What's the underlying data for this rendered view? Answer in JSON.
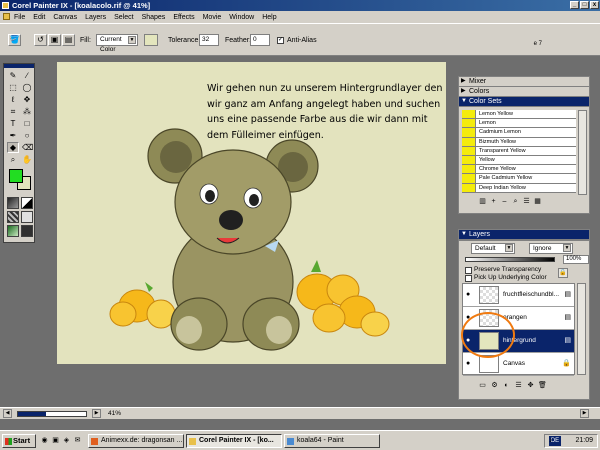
{
  "window": {
    "title": "Corel Painter IX - [koalacolo.rif @ 41%]",
    "minimize": "_",
    "maximize": "□",
    "close": "x"
  },
  "menu": [
    "File",
    "Edit",
    "Canvas",
    "Layers",
    "Select",
    "Shapes",
    "Effects",
    "Movie",
    "Window",
    "Help"
  ],
  "propbar": {
    "fill_label": "Fill:",
    "fill_value": "Current Color",
    "tolerance_label": "Tolerance:",
    "tolerance_value": "32",
    "feather_label": "Feather:",
    "feather_value": "0",
    "antialias_label": "Anti-Alias",
    "antialias_checked": "✓",
    "page_label": "e 7"
  },
  "canvas": {
    "text": "Wir gehen nun zu unserem Hintergrundlayer den wir ganz am Anfang angelegt haben und suchen uns eine passende Farbe aus die wir dann mit dem Fülleimer einfügen."
  },
  "status": {
    "zoom": "41%",
    "zoom_fraction": 0.41
  },
  "panels": {
    "mixer": "Mixer",
    "colors": "Colors",
    "color_sets": "Color Sets",
    "layers": "Layers"
  },
  "color_sets": [
    "Lemon Yellow",
    "Lemon",
    "Cadmium Lemon",
    "Bizmuth Yellow",
    "Transparent Yellow",
    "Yellow",
    "Chrome Yellow",
    "Pale Cadmium Yellow",
    "Deep Indian Yellow"
  ],
  "layers": {
    "composite_method": "Default",
    "depth": "Ignore",
    "opacity": "100%",
    "preserve_transparency": "Preserve Transparency",
    "pick_up_color": "Pick Up Underlying Color",
    "items": [
      {
        "name": "fruchtfleischundbl..."
      },
      {
        "name": "orangen"
      },
      {
        "name": "hintergrund"
      },
      {
        "name": "Canvas"
      }
    ]
  },
  "taskbar": {
    "start": "Start",
    "tasks": [
      "Animexx.de: dragonsan ...",
      "Corel Painter IX - [ko...",
      "koala64 - Paint"
    ],
    "lang": "DE",
    "clock": "21:09"
  },
  "colors": {
    "primary": "#22dd22",
    "secondary": "#e3e5bd",
    "accent": "#0a246a",
    "highlight_circle": "#f07a10"
  }
}
